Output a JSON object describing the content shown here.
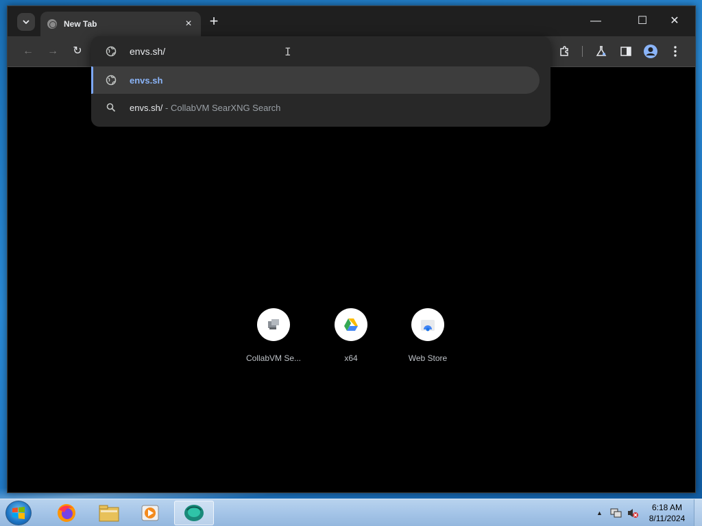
{
  "browser": {
    "tab": {
      "title": "New Tab",
      "close": "×"
    },
    "new_tab": "+",
    "window_controls": {
      "minimize": "—",
      "maximize": "☐",
      "close": "✕"
    },
    "nav": {
      "back": "←",
      "forward": "→",
      "reload": "↻"
    }
  },
  "omnibox": {
    "input_value": "envs.sh/",
    "suggestions": [
      {
        "icon": "globe-icon",
        "text": "envs.sh",
        "selected": true
      },
      {
        "icon": "search-icon",
        "main": "envs.sh/",
        "desc": " - CollabVM SearXNG Search",
        "selected": false
      }
    ]
  },
  "shortcuts": [
    {
      "label": "CollabVM Se...",
      "icon": "collabvm-icon"
    },
    {
      "label": "x64",
      "icon": "google-drive-icon"
    },
    {
      "label": "Web Store",
      "icon": "web-store-icon"
    }
  ],
  "taskbar": {
    "apps": [
      "start-orb",
      "firefox-icon",
      "file-explorer-icon",
      "media-player-icon",
      "browser-app-icon"
    ],
    "clock": {
      "time": "6:18 AM",
      "date": "8/11/2024"
    }
  },
  "colors": {
    "accent": "#8ab4f8",
    "content_bg": "#000000",
    "toolbar_bg": "#353535"
  }
}
